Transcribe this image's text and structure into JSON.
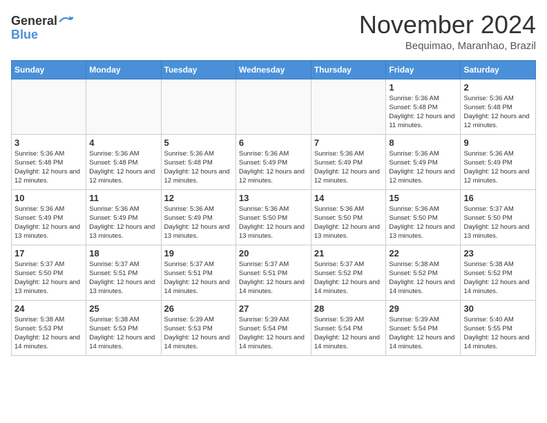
{
  "header": {
    "logo_line1": "General",
    "logo_line2": "Blue",
    "month": "November 2024",
    "location": "Bequimao, Maranhao, Brazil"
  },
  "weekdays": [
    "Sunday",
    "Monday",
    "Tuesday",
    "Wednesday",
    "Thursday",
    "Friday",
    "Saturday"
  ],
  "weeks": [
    [
      {
        "day": "",
        "info": ""
      },
      {
        "day": "",
        "info": ""
      },
      {
        "day": "",
        "info": ""
      },
      {
        "day": "",
        "info": ""
      },
      {
        "day": "",
        "info": ""
      },
      {
        "day": "1",
        "info": "Sunrise: 5:36 AM\nSunset: 5:48 PM\nDaylight: 12 hours and 11 minutes."
      },
      {
        "day": "2",
        "info": "Sunrise: 5:36 AM\nSunset: 5:48 PM\nDaylight: 12 hours and 12 minutes."
      }
    ],
    [
      {
        "day": "3",
        "info": "Sunrise: 5:36 AM\nSunset: 5:48 PM\nDaylight: 12 hours and 12 minutes."
      },
      {
        "day": "4",
        "info": "Sunrise: 5:36 AM\nSunset: 5:48 PM\nDaylight: 12 hours and 12 minutes."
      },
      {
        "day": "5",
        "info": "Sunrise: 5:36 AM\nSunset: 5:48 PM\nDaylight: 12 hours and 12 minutes."
      },
      {
        "day": "6",
        "info": "Sunrise: 5:36 AM\nSunset: 5:49 PM\nDaylight: 12 hours and 12 minutes."
      },
      {
        "day": "7",
        "info": "Sunrise: 5:36 AM\nSunset: 5:49 PM\nDaylight: 12 hours and 12 minutes."
      },
      {
        "day": "8",
        "info": "Sunrise: 5:36 AM\nSunset: 5:49 PM\nDaylight: 12 hours and 12 minutes."
      },
      {
        "day": "9",
        "info": "Sunrise: 5:36 AM\nSunset: 5:49 PM\nDaylight: 12 hours and 12 minutes."
      }
    ],
    [
      {
        "day": "10",
        "info": "Sunrise: 5:36 AM\nSunset: 5:49 PM\nDaylight: 12 hours and 13 minutes."
      },
      {
        "day": "11",
        "info": "Sunrise: 5:36 AM\nSunset: 5:49 PM\nDaylight: 12 hours and 13 minutes."
      },
      {
        "day": "12",
        "info": "Sunrise: 5:36 AM\nSunset: 5:49 PM\nDaylight: 12 hours and 13 minutes."
      },
      {
        "day": "13",
        "info": "Sunrise: 5:36 AM\nSunset: 5:50 PM\nDaylight: 12 hours and 13 minutes."
      },
      {
        "day": "14",
        "info": "Sunrise: 5:36 AM\nSunset: 5:50 PM\nDaylight: 12 hours and 13 minutes."
      },
      {
        "day": "15",
        "info": "Sunrise: 5:36 AM\nSunset: 5:50 PM\nDaylight: 12 hours and 13 minutes."
      },
      {
        "day": "16",
        "info": "Sunrise: 5:37 AM\nSunset: 5:50 PM\nDaylight: 12 hours and 13 minutes."
      }
    ],
    [
      {
        "day": "17",
        "info": "Sunrise: 5:37 AM\nSunset: 5:50 PM\nDaylight: 12 hours and 13 minutes."
      },
      {
        "day": "18",
        "info": "Sunrise: 5:37 AM\nSunset: 5:51 PM\nDaylight: 12 hours and 13 minutes."
      },
      {
        "day": "19",
        "info": "Sunrise: 5:37 AM\nSunset: 5:51 PM\nDaylight: 12 hours and 14 minutes."
      },
      {
        "day": "20",
        "info": "Sunrise: 5:37 AM\nSunset: 5:51 PM\nDaylight: 12 hours and 14 minutes."
      },
      {
        "day": "21",
        "info": "Sunrise: 5:37 AM\nSunset: 5:52 PM\nDaylight: 12 hours and 14 minutes."
      },
      {
        "day": "22",
        "info": "Sunrise: 5:38 AM\nSunset: 5:52 PM\nDaylight: 12 hours and 14 minutes."
      },
      {
        "day": "23",
        "info": "Sunrise: 5:38 AM\nSunset: 5:52 PM\nDaylight: 12 hours and 14 minutes."
      }
    ],
    [
      {
        "day": "24",
        "info": "Sunrise: 5:38 AM\nSunset: 5:53 PM\nDaylight: 12 hours and 14 minutes."
      },
      {
        "day": "25",
        "info": "Sunrise: 5:38 AM\nSunset: 5:53 PM\nDaylight: 12 hours and 14 minutes."
      },
      {
        "day": "26",
        "info": "Sunrise: 5:39 AM\nSunset: 5:53 PM\nDaylight: 12 hours and 14 minutes."
      },
      {
        "day": "27",
        "info": "Sunrise: 5:39 AM\nSunset: 5:54 PM\nDaylight: 12 hours and 14 minutes."
      },
      {
        "day": "28",
        "info": "Sunrise: 5:39 AM\nSunset: 5:54 PM\nDaylight: 12 hours and 14 minutes."
      },
      {
        "day": "29",
        "info": "Sunrise: 5:39 AM\nSunset: 5:54 PM\nDaylight: 12 hours and 14 minutes."
      },
      {
        "day": "30",
        "info": "Sunrise: 5:40 AM\nSunset: 5:55 PM\nDaylight: 12 hours and 14 minutes."
      }
    ]
  ]
}
